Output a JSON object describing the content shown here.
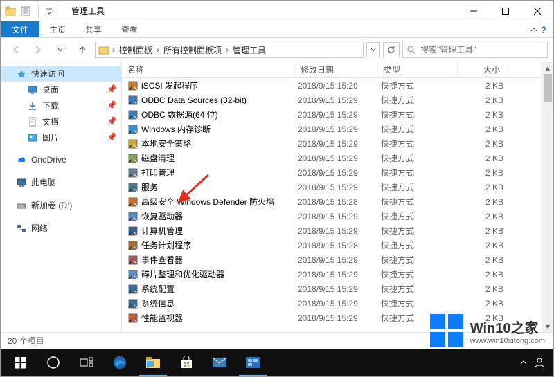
{
  "window": {
    "title": "管理工具"
  },
  "ribbon": {
    "file": "文件",
    "home": "主页",
    "share": "共享",
    "view": "查看"
  },
  "breadcrumbs": {
    "b0": "控制面板",
    "b1": "所有控制面板项",
    "b2": "管理工具"
  },
  "search": {
    "placeholder": "搜索\"管理工具\""
  },
  "sidebar": {
    "quick_access": "快速访问",
    "desktop": "桌面",
    "downloads": "下载",
    "documents": "文档",
    "pictures": "图片",
    "onedrive": "OneDrive",
    "thispc": "此电脑",
    "newvol": "新加卷 (D:)",
    "network": "网络"
  },
  "columns": {
    "name": "名称",
    "date": "修改日期",
    "type": "类型",
    "size": "大小"
  },
  "files": [
    {
      "name": "iSCSI 发起程序",
      "date": "2018/9/15 15:29",
      "type": "快捷方式",
      "size": "2 KB",
      "ico": "#c08030"
    },
    {
      "name": "ODBC Data Sources (32-bit)",
      "date": "2018/9/15 15:29",
      "type": "快捷方式",
      "size": "2 KB",
      "ico": "#3a7db8"
    },
    {
      "name": "ODBC 数据源(64 位)",
      "date": "2018/9/15 15:29",
      "type": "快捷方式",
      "size": "2 KB",
      "ico": "#3a7db8"
    },
    {
      "name": "Windows 内存诊断",
      "date": "2018/9/15 15:29",
      "type": "快捷方式",
      "size": "2 KB",
      "ico": "#3a90d0"
    },
    {
      "name": "本地安全策略",
      "date": "2018/9/15 15:29",
      "type": "快捷方式",
      "size": "2 KB",
      "ico": "#caa83a"
    },
    {
      "name": "磁盘清理",
      "date": "2018/9/15 15:29",
      "type": "快捷方式",
      "size": "2 KB",
      "ico": "#8aa05a"
    },
    {
      "name": "打印管理",
      "date": "2018/9/15 15:29",
      "type": "快捷方式",
      "size": "2 KB",
      "ico": "#6a7a8a"
    },
    {
      "name": "服务",
      "date": "2018/9/15 15:29",
      "type": "快捷方式",
      "size": "2 KB",
      "ico": "#4a7a8a"
    },
    {
      "name": "高级安全 Windows Defender 防火墙",
      "date": "2018/9/15 15:28",
      "type": "快捷方式",
      "size": "2 KB",
      "ico": "#d07030"
    },
    {
      "name": "恢复驱动器",
      "date": "2018/9/15 15:29",
      "type": "快捷方式",
      "size": "2 KB",
      "ico": "#5a8ac0"
    },
    {
      "name": "计算机管理",
      "date": "2018/9/15 15:29",
      "type": "快捷方式",
      "size": "2 KB",
      "ico": "#3a6090"
    },
    {
      "name": "任务计划程序",
      "date": "2018/9/15 15:28",
      "type": "快捷方式",
      "size": "2 KB",
      "ico": "#a0703a"
    },
    {
      "name": "事件查看器",
      "date": "2018/9/15 15:29",
      "type": "快捷方式",
      "size": "2 KB",
      "ico": "#a05a5a"
    },
    {
      "name": "碎片整理和优化驱动器",
      "date": "2018/9/15 15:29",
      "type": "快捷方式",
      "size": "2 KB",
      "ico": "#5a90c0"
    },
    {
      "name": "系统配置",
      "date": "2018/9/15 15:29",
      "type": "快捷方式",
      "size": "2 KB",
      "ico": "#3a6a9a"
    },
    {
      "name": "系统信息",
      "date": "2018/9/15 15:29",
      "type": "快捷方式",
      "size": "2 KB",
      "ico": "#3a6a9a"
    },
    {
      "name": "性能监视器",
      "date": "2018/9/15 15:29",
      "type": "快捷方式",
      "size": "2 KB",
      "ico": "#c05a3a"
    }
  ],
  "status": {
    "count": "20 个项目"
  },
  "watermark": {
    "title": "Win10之家",
    "url": "www.win10xitong.com"
  }
}
